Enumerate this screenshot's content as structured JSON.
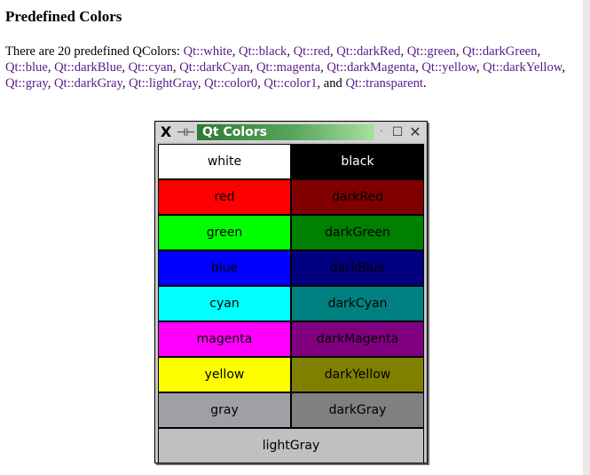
{
  "heading": "Predefined Colors",
  "paragraph": {
    "intro": "There are 20 predefined QColors: ",
    "items": [
      {
        "text": "Qt::white",
        "sep": ", "
      },
      {
        "text": "Qt::black",
        "sep": ", "
      },
      {
        "text": "Qt::red",
        "sep": ", "
      },
      {
        "text": "Qt::darkRed",
        "sep": ", "
      },
      {
        "text": "Qt::green",
        "sep": ", "
      },
      {
        "text": "Qt::darkGreen",
        "sep": ", "
      },
      {
        "text": "Qt::blue",
        "sep": ", "
      },
      {
        "text": "Qt::darkBlue",
        "sep": ", "
      },
      {
        "text": "Qt::cyan",
        "sep": ", "
      },
      {
        "text": "Qt::darkCyan",
        "sep": ", "
      },
      {
        "text": "Qt::magenta",
        "sep": ", "
      },
      {
        "text": "Qt::darkMagenta",
        "sep": ", "
      },
      {
        "text": "Qt::yellow",
        "sep": ", "
      },
      {
        "text": "Qt::darkYellow",
        "sep": ", "
      },
      {
        "text": "Qt::gray",
        "sep": ", "
      },
      {
        "text": "Qt::darkGray",
        "sep": ", "
      },
      {
        "text": "Qt::lightGray",
        "sep": ", "
      },
      {
        "text": "Qt::color0",
        "sep": ", "
      },
      {
        "text": "Qt::color1",
        "sep": ", and "
      },
      {
        "text": "Qt::transparent",
        "sep": "."
      }
    ]
  },
  "window": {
    "title": "Qt Colors",
    "icons": {
      "app": "x-logo-icon",
      "pin": "pin-icon",
      "minimize": "minimize-icon",
      "maximize": "maximize-icon",
      "close": "close-icon"
    }
  },
  "swatches": [
    {
      "label": "white",
      "bg": "#ffffff",
      "fg": "#000000"
    },
    {
      "label": "black",
      "bg": "#000000",
      "fg": "#ffffff"
    },
    {
      "label": "red",
      "bg": "#ff0000",
      "fg": "#000000"
    },
    {
      "label": "darkRed",
      "bg": "#800000",
      "fg": "#000000"
    },
    {
      "label": "green",
      "bg": "#00ff00",
      "fg": "#000000"
    },
    {
      "label": "darkGreen",
      "bg": "#008000",
      "fg": "#000000"
    },
    {
      "label": "blue",
      "bg": "#0000ff",
      "fg": "#000000"
    },
    {
      "label": "darkBlue",
      "bg": "#000080",
      "fg": "#000000"
    },
    {
      "label": "cyan",
      "bg": "#00ffff",
      "fg": "#000000"
    },
    {
      "label": "darkCyan",
      "bg": "#008080",
      "fg": "#000000"
    },
    {
      "label": "magenta",
      "bg": "#ff00ff",
      "fg": "#000000"
    },
    {
      "label": "darkMagenta",
      "bg": "#800080",
      "fg": "#000000"
    },
    {
      "label": "yellow",
      "bg": "#ffff00",
      "fg": "#000000"
    },
    {
      "label": "darkYellow",
      "bg": "#808000",
      "fg": "#000000"
    },
    {
      "label": "gray",
      "bg": "#a0a0a4",
      "fg": "#000000"
    },
    {
      "label": "darkGray",
      "bg": "#808080",
      "fg": "#000000"
    },
    {
      "label": "lightGray",
      "bg": "#c0c0c0",
      "fg": "#000000"
    }
  ]
}
